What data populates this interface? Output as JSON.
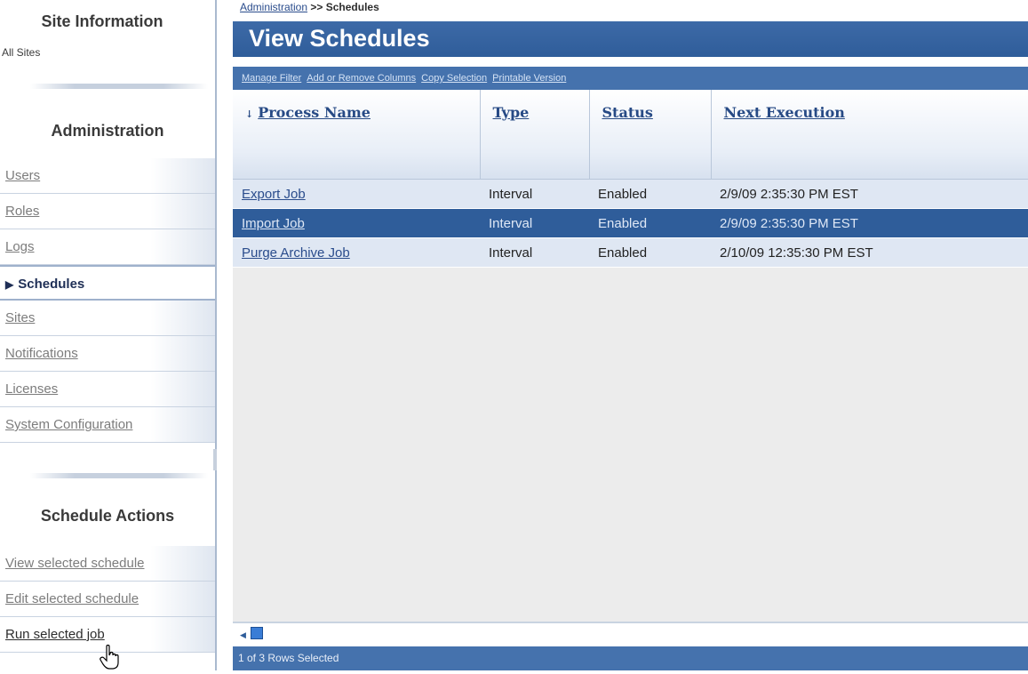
{
  "sidebar": {
    "site_info": {
      "title": "Site Information",
      "subtitle": "All Sites"
    },
    "administration": {
      "title": "Administration",
      "items": [
        {
          "label": "Users",
          "active": false
        },
        {
          "label": "Roles",
          "active": false
        },
        {
          "label": "Logs",
          "active": false
        },
        {
          "label": "Schedules",
          "active": true
        },
        {
          "label": "Sites",
          "active": false
        },
        {
          "label": "Notifications",
          "active": false
        },
        {
          "label": "Licenses",
          "active": false
        },
        {
          "label": "System Configuration",
          "active": false
        }
      ]
    },
    "schedule_actions": {
      "title": "Schedule Actions",
      "items": [
        {
          "label": "View selected schedule"
        },
        {
          "label": "Edit selected schedule"
        },
        {
          "label": "Run selected job"
        }
      ]
    }
  },
  "breadcrumb": {
    "parent": "Administration",
    "separator": ">>",
    "current": "Schedules"
  },
  "main": {
    "title": "View Schedules",
    "toolbar": [
      "Manage Filter",
      "Add or Remove Columns",
      "Copy Selection",
      "Printable Version"
    ],
    "table": {
      "columns": [
        "Process Name",
        "Type",
        "Status",
        "Next Execution"
      ],
      "sort_indicator": "↓",
      "rows": [
        {
          "process": "Export Job",
          "type": "Interval",
          "status": "Enabled",
          "next": "2/9/09 2:35:30 PM EST",
          "selected": false
        },
        {
          "process": "Import Job",
          "type": "Interval",
          "status": "Enabled",
          "next": "2/9/09 2:35:30 PM EST",
          "selected": true
        },
        {
          "process": "Purge Archive Job",
          "type": "Interval",
          "status": "Enabled",
          "next": "2/10/09 12:35:30 PM EST",
          "selected": false
        }
      ]
    },
    "status": "1 of 3 Rows Selected"
  },
  "icons": {
    "sort": "sort-down-arrow-icon",
    "active_item": "triangle-right-icon",
    "scroll_left": "arrow-left-icon",
    "cursor": "hand-pointer-icon"
  },
  "colors": {
    "header_blue": "#2f5d9a",
    "selected_row": "#2f5d9a",
    "row_bg": "#dfe7f3",
    "link": "#2a4c8c"
  }
}
